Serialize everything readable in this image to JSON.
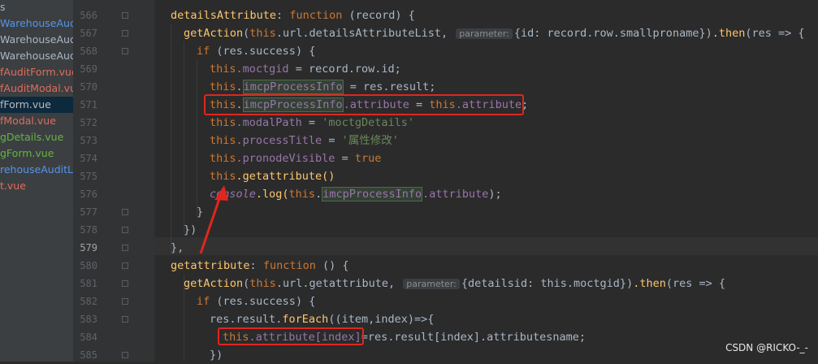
{
  "sidebar": {
    "files": [
      {
        "name": "s",
        "color": "#a9b7c6"
      },
      {
        "name": "WarehouseAudi",
        "color": "#5394ec"
      },
      {
        "name": "WarehouseAudi",
        "color": "#a9b7c6"
      },
      {
        "name": "WarehouseAudi",
        "color": "#a9b7c6"
      },
      {
        "name": "fAuditForm.vue",
        "color": "#e06c5c"
      },
      {
        "name": "fAuditModal.vue",
        "color": "#e06c5c"
      },
      {
        "name": "fForm.vue",
        "color": "#bbbbbb"
      },
      {
        "name": "fModal.vue",
        "color": "#e06c5c"
      },
      {
        "name": "gDetails.vue",
        "color": "#62b543"
      },
      {
        "name": "gForm.vue",
        "color": "#62b543"
      },
      {
        "name": "rehouseAuditLis",
        "color": "#5394ec"
      },
      {
        "name": "t.vue",
        "color": "#e06c5c"
      }
    ],
    "selected_index": 6
  },
  "editor": {
    "current_line": "579",
    "line_numbers": [
      "566",
      "567",
      "568",
      "569",
      "570",
      "571",
      "572",
      "573",
      "574",
      "575",
      "576",
      "577",
      "578",
      "579",
      "580",
      "581",
      "582",
      "583",
      "584",
      "585"
    ],
    "param_hint": "parameter:",
    "tokens": {
      "detailsAttribute": "detailsAttribute",
      "function": "function",
      "record": "(record) {",
      "getAction": "getAction",
      "this": "this",
      "url_detailsAttributeList": ".url.detailsAttributeList,",
      "arg1": "{id: record.row.smallproname}",
      "then": ".then",
      "res_arrow": "(res => {",
      "if": "if",
      "res_success": "(res.success) {",
      "moctgid": ".moctgid",
      "record_row_id": "= record.row.id;",
      "imcpProcessInfo": "imcpProcessInfo",
      "res_result": "= res.result;",
      "attribute": ".attribute",
      "eq": "=",
      "this_attribute": "this.attribute;",
      "modalPath": ".modalPath",
      "modalPath_val": "'moctgDetails'",
      "processTitle": ".processTitle",
      "processTitle_val": "'属性修改'",
      "pronodeVisible": ".pronodeVisible",
      "true": "true",
      "getattribute_call": ".getattribute()",
      "console": "console",
      "log": ".log(",
      "close_brace": "}",
      "close_paren": "})",
      "close_comma": "},",
      "getattribute": "getattribute",
      "empty_args": "() {",
      "url_getattribute": ".url.getattribute,",
      "arg2": "{detailsid: this.moctgid}",
      "forEach_lhs": "res.result.",
      "forEach": "forEach",
      "item_index": "((item,index)=>{",
      "attribute_index": ".attribute[index]",
      "rhs": "=res.result[index].attributesname;"
    }
  },
  "watermark": "CSDN @RICKO-_-"
}
